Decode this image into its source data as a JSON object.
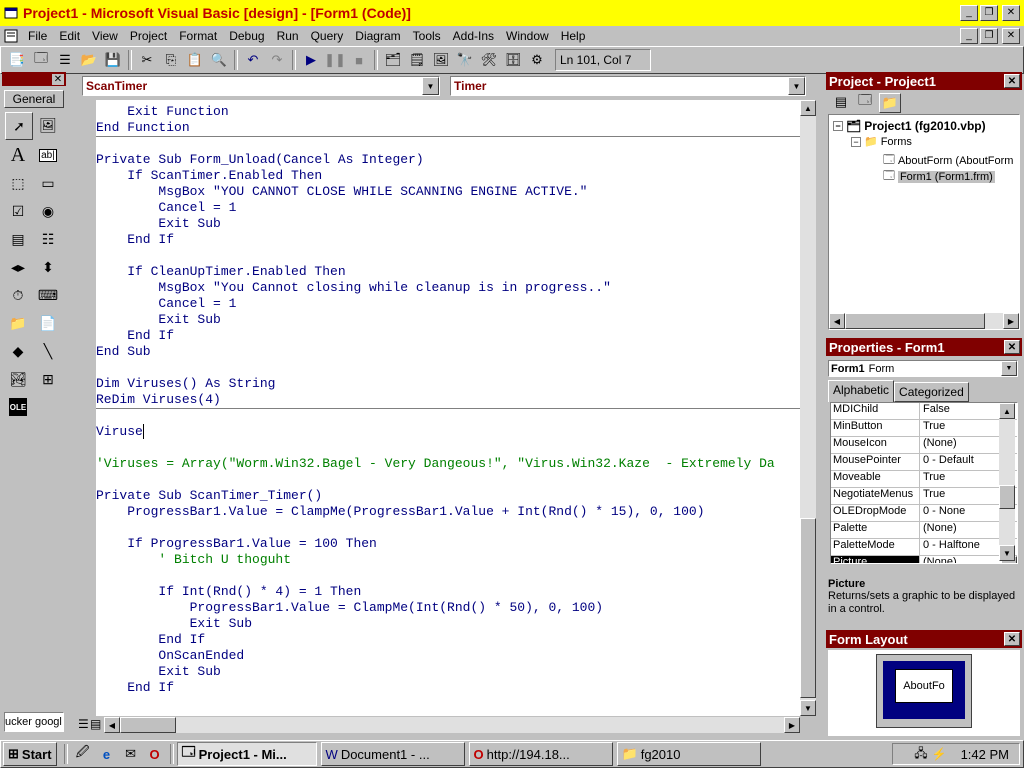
{
  "window": {
    "title": "Project1 - Microsoft Visual Basic [design] - [Form1 (Code)]",
    "minimize_icon": "minimize-icon",
    "restore_icon": "restore-icon",
    "close_icon": "close-icon"
  },
  "menu": [
    "File",
    "Edit",
    "View",
    "Project",
    "Format",
    "Debug",
    "Run",
    "Query",
    "Diagram",
    "Tools",
    "Add-Ins",
    "Window",
    "Help"
  ],
  "status": {
    "cursor_pos": "Ln 101, Col 7"
  },
  "toolbox": {
    "tab_label": "General",
    "bottom_text": "ucker googl"
  },
  "code_window": {
    "object_combo": "ScanTimer",
    "procedure_combo": "Timer",
    "lines": [
      "    Exit Function",
      "End Function",
      "",
      "Private Sub Form_Unload(Cancel As Integer)",
      "    If ScanTimer.Enabled Then",
      "        MsgBox \"YOU CANNOT CLOSE WHILE SCANNING ENGINE ACTIVE.\"",
      "        Cancel = 1",
      "        Exit Sub",
      "    End If",
      "",
      "    If CleanUpTimer.Enabled Then",
      "        MsgBox \"You Cannot closing while cleanup is in progress..\"",
      "        Cancel = 1",
      "        Exit Sub",
      "    End If",
      "End Sub",
      "",
      "Dim Viruses() As String",
      "ReDim Viruses(4)",
      "",
      "Viruse",
      "",
      "'Viruses = Array(\"Worm.Win32.Bagel - Very Dangeous!\", \"Virus.Win32.Kaze  - Extremely Da",
      "",
      "Private Sub ScanTimer_Timer()",
      "    ProgressBar1.Value = ClampMe(ProgressBar1.Value + Int(Rnd() * 15), 0, 100)",
      "",
      "    If ProgressBar1.Value = 100 Then",
      "        ' Bitch U thoguht",
      "",
      "        If Int(Rnd() * 4) = 1 Then",
      "            ProgressBar1.Value = ClampMe(Int(Rnd() * 50), 0, 100)",
      "            Exit Sub",
      "        End If",
      "        OnScanEnded",
      "        Exit Sub",
      "    End If"
    ]
  },
  "project_panel": {
    "title": "Project - Project1",
    "root": "Project1 (fg2010.vbp)",
    "folder": "Forms",
    "items": [
      "AboutForm (AboutForm",
      "Form1 (Form1.frm)"
    ]
  },
  "properties_panel": {
    "title": "Properties - Form1",
    "object_name": "Form1",
    "object_type": "Form",
    "tabs": [
      "Alphabetic",
      "Categorized"
    ],
    "rows": [
      {
        "name": "MDIChild",
        "value": "False"
      },
      {
        "name": "MinButton",
        "value": "True"
      },
      {
        "name": "MouseIcon",
        "value": "(None)"
      },
      {
        "name": "MousePointer",
        "value": "0 - Default"
      },
      {
        "name": "Moveable",
        "value": "True"
      },
      {
        "name": "NegotiateMenus",
        "value": "True"
      },
      {
        "name": "OLEDropMode",
        "value": "0 - None"
      },
      {
        "name": "Palette",
        "value": "(None)"
      },
      {
        "name": "PaletteMode",
        "value": "0 - Halftone"
      },
      {
        "name": "Picture",
        "value": "(None)"
      }
    ],
    "desc_title": "Picture",
    "desc_text": "Returns/sets a graphic to be displayed in a control."
  },
  "form_layout": {
    "title": "Form Layout",
    "form_label": "AboutFo"
  },
  "taskbar": {
    "start": "Start",
    "tasks": [
      "Project1 - Mi...",
      "Document1 - ...",
      "http://194.18...",
      "fg2010"
    ],
    "clock": "1:42 PM"
  },
  "colors": {
    "title_bar": "#ffff00",
    "title_text": "#c00000",
    "panel_title": "#800000",
    "code_text": "#000080",
    "comment": "#008000"
  }
}
